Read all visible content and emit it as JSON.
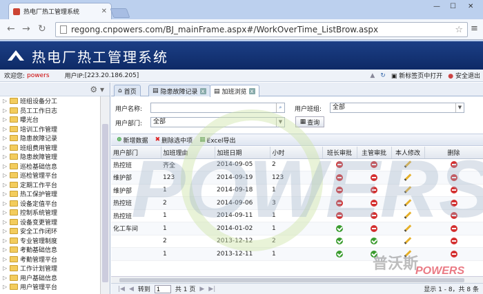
{
  "browser": {
    "tab_title": "热电厂热工管理系统",
    "url": "regong.cnpowers.com/BJ_mainFrame.aspx#/WorkOverTime_ListBrow.aspx"
  },
  "app": {
    "title": "热电厂热工管理系统",
    "welcome_label": "欢迎您:",
    "username": "powers",
    "ip_label": "用户IP:",
    "ip_value": "[223.20.186.205]",
    "open_new_tab": "新标签页中打开",
    "logout": "安全退出"
  },
  "sidebar": {
    "items": [
      "班组设备分工",
      "员工工作日志",
      "曝光台",
      "培训工作管理",
      "隐患故障记录",
      "班组费用管理",
      "隐患故障管理",
      "巡检基础信息",
      "巡检管理平台",
      "定期工作平台",
      "热工保护管理",
      "设备定值平台",
      "控制系统管理",
      "设备变更管理",
      "安全工作闭环",
      "专业管理制度",
      "考勤基础信息",
      "考勤管理平台",
      "工作计划管理",
      "用户基础信息",
      "用户管理平台"
    ]
  },
  "tabs": [
    {
      "label": "首页"
    },
    {
      "label": "隐患故障记录"
    },
    {
      "label": "加班浏览"
    }
  ],
  "search": {
    "user_name_label": "用户名称:",
    "user_name_value": "",
    "user_team_label": "用户班组:",
    "user_team_value": "全部",
    "user_dept_label": "用户部门:",
    "user_dept_value": "全部",
    "query_button": "查询"
  },
  "toolbar": {
    "add": "新增数据",
    "delete_selected": "删除选中项",
    "excel_export": "Excel导出"
  },
  "table": {
    "headers": [
      "用户部门",
      "加班理由",
      "加班日期",
      "小时",
      "班长审批",
      "主管审批",
      "本人修改",
      "删除"
    ],
    "rows": [
      {
        "dept": "热控班",
        "reason": "齐全",
        "date": "2014-09-05",
        "hours": "2",
        "lead": "red",
        "mgr": "red"
      },
      {
        "dept": "维护部",
        "reason": "123",
        "date": "2014-09-19",
        "hours": "123",
        "lead": "red",
        "mgr": "red"
      },
      {
        "dept": "维护部",
        "reason": "1",
        "date": "2014-09-18",
        "hours": "1",
        "lead": "red",
        "mgr": "red"
      },
      {
        "dept": "热控班",
        "reason": "2",
        "date": "2014-09-06",
        "hours": "3",
        "lead": "red",
        "mgr": "red"
      },
      {
        "dept": "热控班",
        "reason": "1",
        "date": "2014-09-11",
        "hours": "1",
        "lead": "red",
        "mgr": "red"
      },
      {
        "dept": "化工车间",
        "reason": "1",
        "date": "2014-01-02",
        "hours": "1",
        "lead": "green",
        "mgr": "red"
      },
      {
        "dept": "",
        "reason": "2",
        "date": "2013-12-12",
        "hours": "2",
        "lead": "green",
        "mgr": "green"
      },
      {
        "dept": "",
        "reason": "1",
        "date": "2013-12-11",
        "hours": "1",
        "lead": "green",
        "mgr": "green"
      }
    ]
  },
  "pager": {
    "goto_label": "转到",
    "page_value": "1",
    "total_pages": "共 1 页",
    "info": "显示 1 - 8，共 8 条"
  },
  "watermark": {
    "brand": "POWERS",
    "brand_cn": "普沃斯"
  },
  "colors": {
    "header_bg": "#163a7c",
    "accent_red": "#cc0000"
  }
}
